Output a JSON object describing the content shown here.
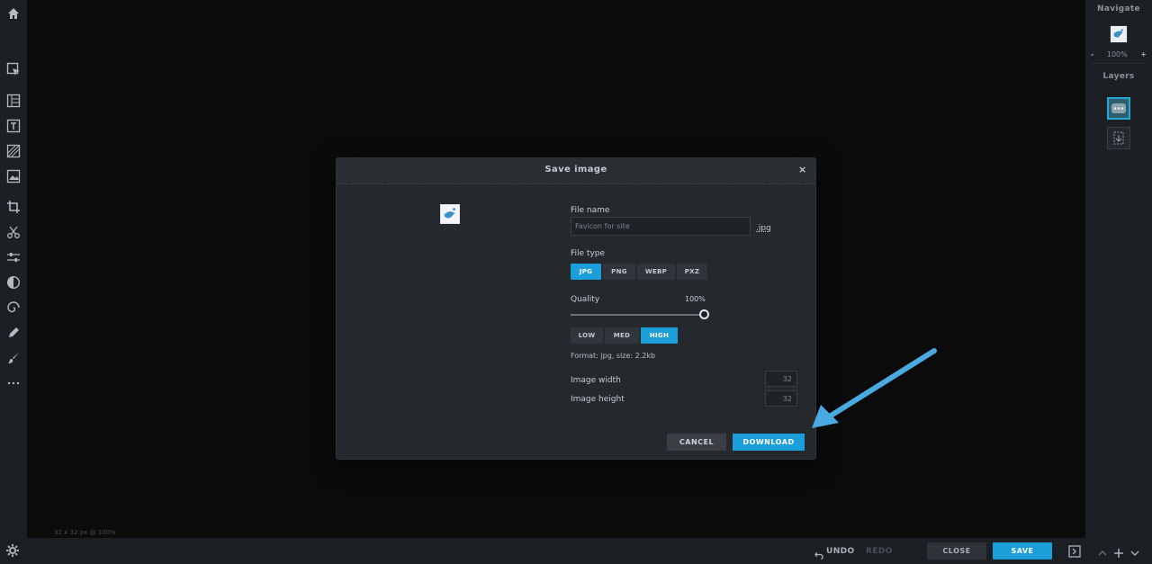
{
  "colors": {
    "accent": "#1c9fd8",
    "arrow": "#4aa9e0",
    "bg": "#0c0d0f",
    "panel": "#1c1f23"
  },
  "toolbar_left": {
    "icons": [
      "home-icon",
      "select-icon",
      "layout-icon",
      "text-icon",
      "pattern-icon",
      "image-icon",
      "crop-icon",
      "scissors-icon",
      "adjust-icon",
      "contrast-icon",
      "spiral-icon",
      "pencil-icon",
      "brush-icon",
      "more-icon"
    ]
  },
  "canvas": {
    "info": "32 x 32 px @ 100%"
  },
  "right_panel": {
    "navigate_title": "Navigate",
    "zoom_minus": "-",
    "zoom_value": "100%",
    "zoom_plus": "+",
    "layers_title": "Layers"
  },
  "bottom_bar": {
    "undo": "UNDO",
    "redo": "REDO",
    "close": "CLOSE",
    "save": "SAVE"
  },
  "dialog": {
    "title": "Save image",
    "close": "×",
    "file_name_label": "File name",
    "file_name_value": "Favicon for site",
    "extension": ".jpg",
    "file_type_label": "File type",
    "file_types": [
      "JPG",
      "PNG",
      "WEBP",
      "PXZ"
    ],
    "file_type_selected": "JPG",
    "quality_label": "Quality",
    "quality_value": "100%",
    "quality_fraction": 1.0,
    "quality_presets": [
      "LOW",
      "MED",
      "HIGH"
    ],
    "quality_preset_selected": "HIGH",
    "format_info": "Format: jpg, size: 2.2kb",
    "image_width_label": "Image width",
    "image_width_value": "32",
    "image_height_label": "Image height",
    "image_height_value": "32",
    "cancel": "CANCEL",
    "download": "DOWNLOAD"
  }
}
